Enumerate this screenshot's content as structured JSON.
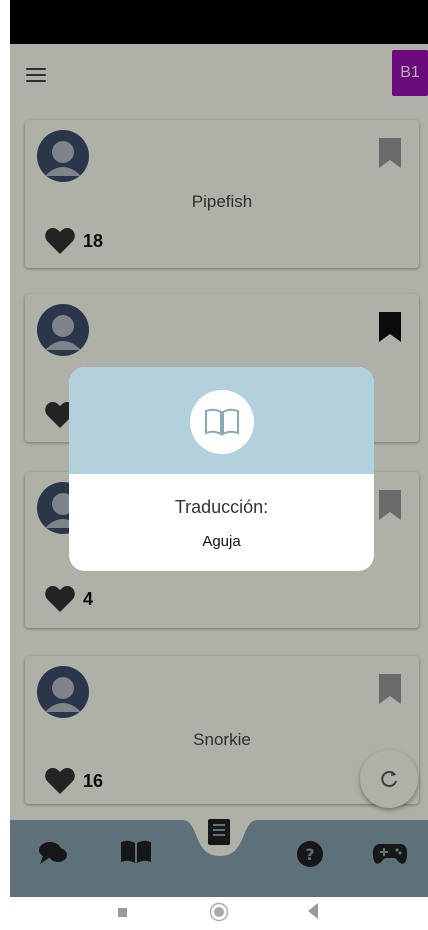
{
  "header": {
    "level_badge": "B1",
    "menu_icon": "hamburger-menu-icon"
  },
  "cards": [
    {
      "title": "Pipefish",
      "likes": "18",
      "bookmark_color": "#9a9a9a"
    },
    {
      "title": "",
      "likes": "",
      "bookmark_color": "#111111"
    },
    {
      "title": "",
      "likes": "4",
      "bookmark_color": "#9a9a9a"
    },
    {
      "title": "Snorkie",
      "likes": "16",
      "bookmark_color": "#9a9a9a"
    }
  ],
  "modal": {
    "icon": "open-book-icon",
    "title": "Traducción:",
    "value": "Aguja"
  },
  "bottom_nav": {
    "items": [
      "chat-icon",
      "book-icon",
      "notes-icon",
      "help-icon",
      "gamepad-icon"
    ],
    "bar_color": "#87a2b1"
  },
  "colors": {
    "accent_badge": "#9b11b5",
    "modal_header": "#b3d0dd",
    "card_bg": "#fbfdf0"
  }
}
